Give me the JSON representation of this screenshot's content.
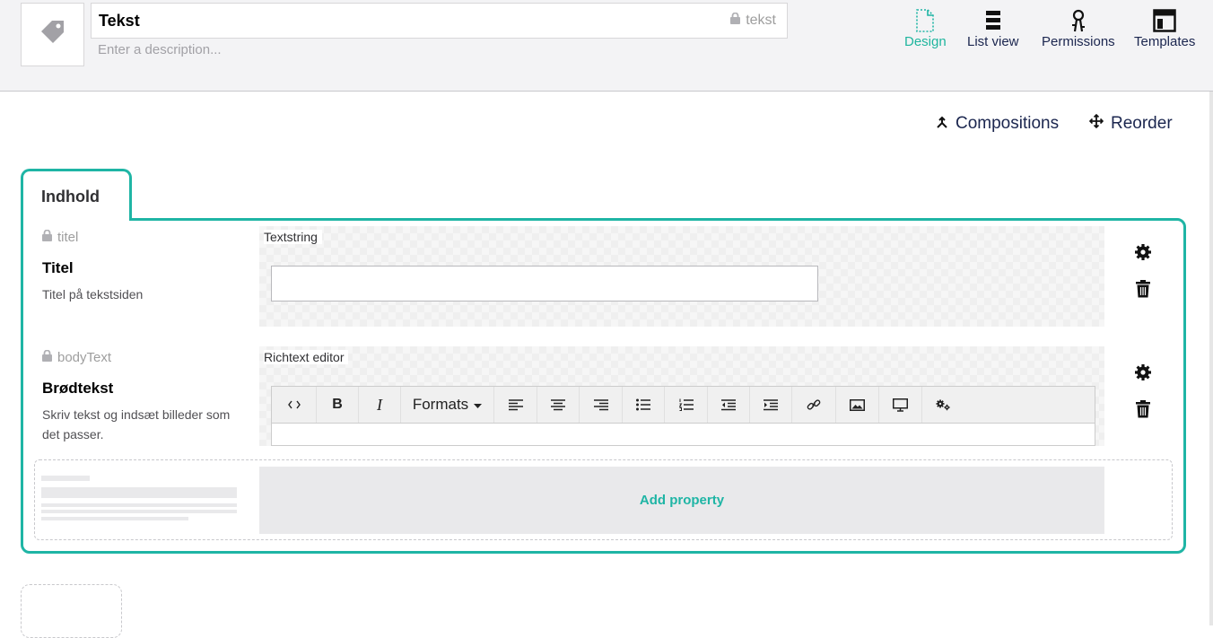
{
  "header": {
    "name": "Tekst",
    "alias": "tekst",
    "description_placeholder": "Enter a description...",
    "icon": "tag-icon",
    "nav": [
      {
        "label": "Design",
        "icon": "design-icon",
        "active": true
      },
      {
        "label": "List view",
        "icon": "list-view-icon",
        "active": false
      },
      {
        "label": "Permissions",
        "icon": "permissions-icon",
        "active": false
      },
      {
        "label": "Templates",
        "icon": "templates-icon",
        "active": false
      }
    ]
  },
  "actions": {
    "compositions": "Compositions",
    "reorder": "Reorder"
  },
  "tab": {
    "label": "Indhold"
  },
  "properties": [
    {
      "alias": "titel",
      "label": "Titel",
      "description": "Titel på tekstsiden",
      "editor": "Textstring"
    },
    {
      "alias": "bodyText",
      "label": "Brødtekst",
      "description": "Skriv tekst og indsæt billeder som det passer.",
      "editor": "Richtext editor"
    }
  ],
  "rte": {
    "formats_label": "Formats",
    "toolbar": [
      "code-icon",
      "bold-icon",
      "italic-icon",
      "formats-dropdown",
      "align-left-icon",
      "align-center-icon",
      "align-right-icon",
      "bullet-list-icon",
      "numbered-list-icon",
      "outdent-icon",
      "indent-icon",
      "link-icon",
      "image-icon",
      "embed-icon",
      "macro-icon"
    ]
  },
  "add_property": "Add property",
  "colors": {
    "accent": "#1fb5a5",
    "header_bg": "#f3f3f5"
  }
}
